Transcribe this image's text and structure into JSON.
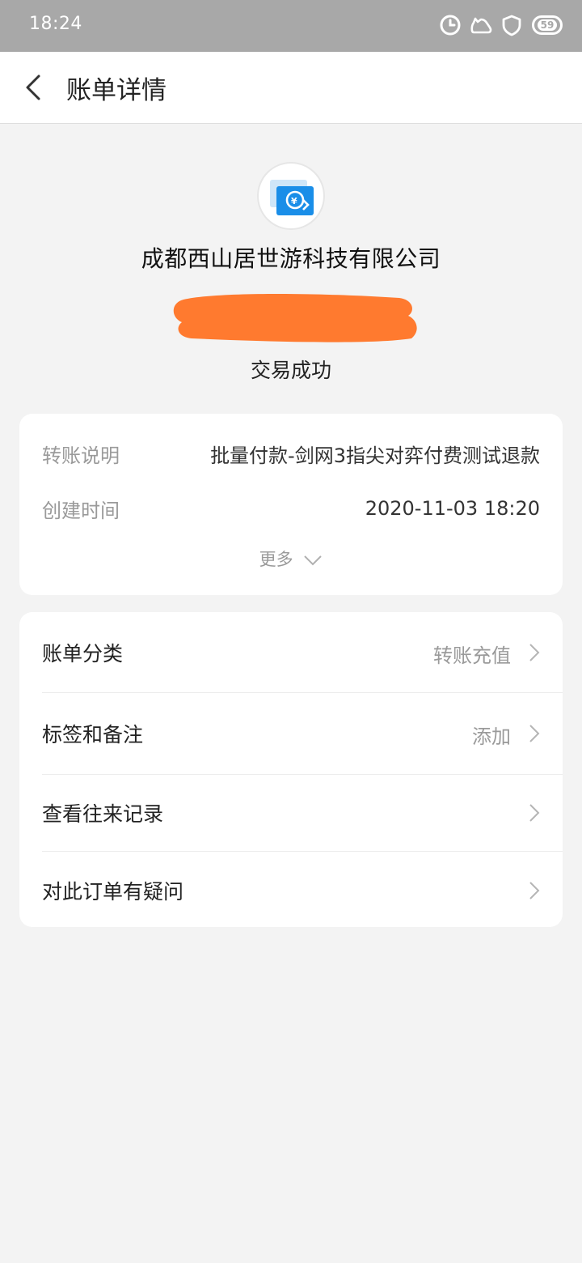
{
  "status_bar": {
    "time": "18:24",
    "icons": [
      "alarm-icon",
      "notification-icon",
      "shield-icon",
      "battery-icon"
    ],
    "battery_level": "59"
  },
  "nav": {
    "title": "账单详情",
    "back_icon": "chevron-left-icon"
  },
  "header": {
    "merchant_icon": "transfer-refund-icon",
    "company": "成都西山居世游科技有限公司",
    "status": "交易成功",
    "redaction_color": "#ff7a2f"
  },
  "details": {
    "rows": [
      {
        "label": "转账说明",
        "value": "批量付款-剑网3指尖对弈付费测试退款"
      },
      {
        "label": "创建时间",
        "value": "2020-11-03 18:20"
      }
    ],
    "more_label": "更多"
  },
  "actions": {
    "items": [
      {
        "label": "账单分类",
        "value": "转账充值"
      },
      {
        "label": "标签和备注",
        "value": "添加"
      },
      {
        "label": "查看往来记录",
        "value": ""
      },
      {
        "label": "对此订单有疑问",
        "value": ""
      }
    ]
  },
  "colors": {
    "accent": "#1a8ee8",
    "background": "#f3f3f3",
    "statusbar": "#a8a8a8"
  }
}
